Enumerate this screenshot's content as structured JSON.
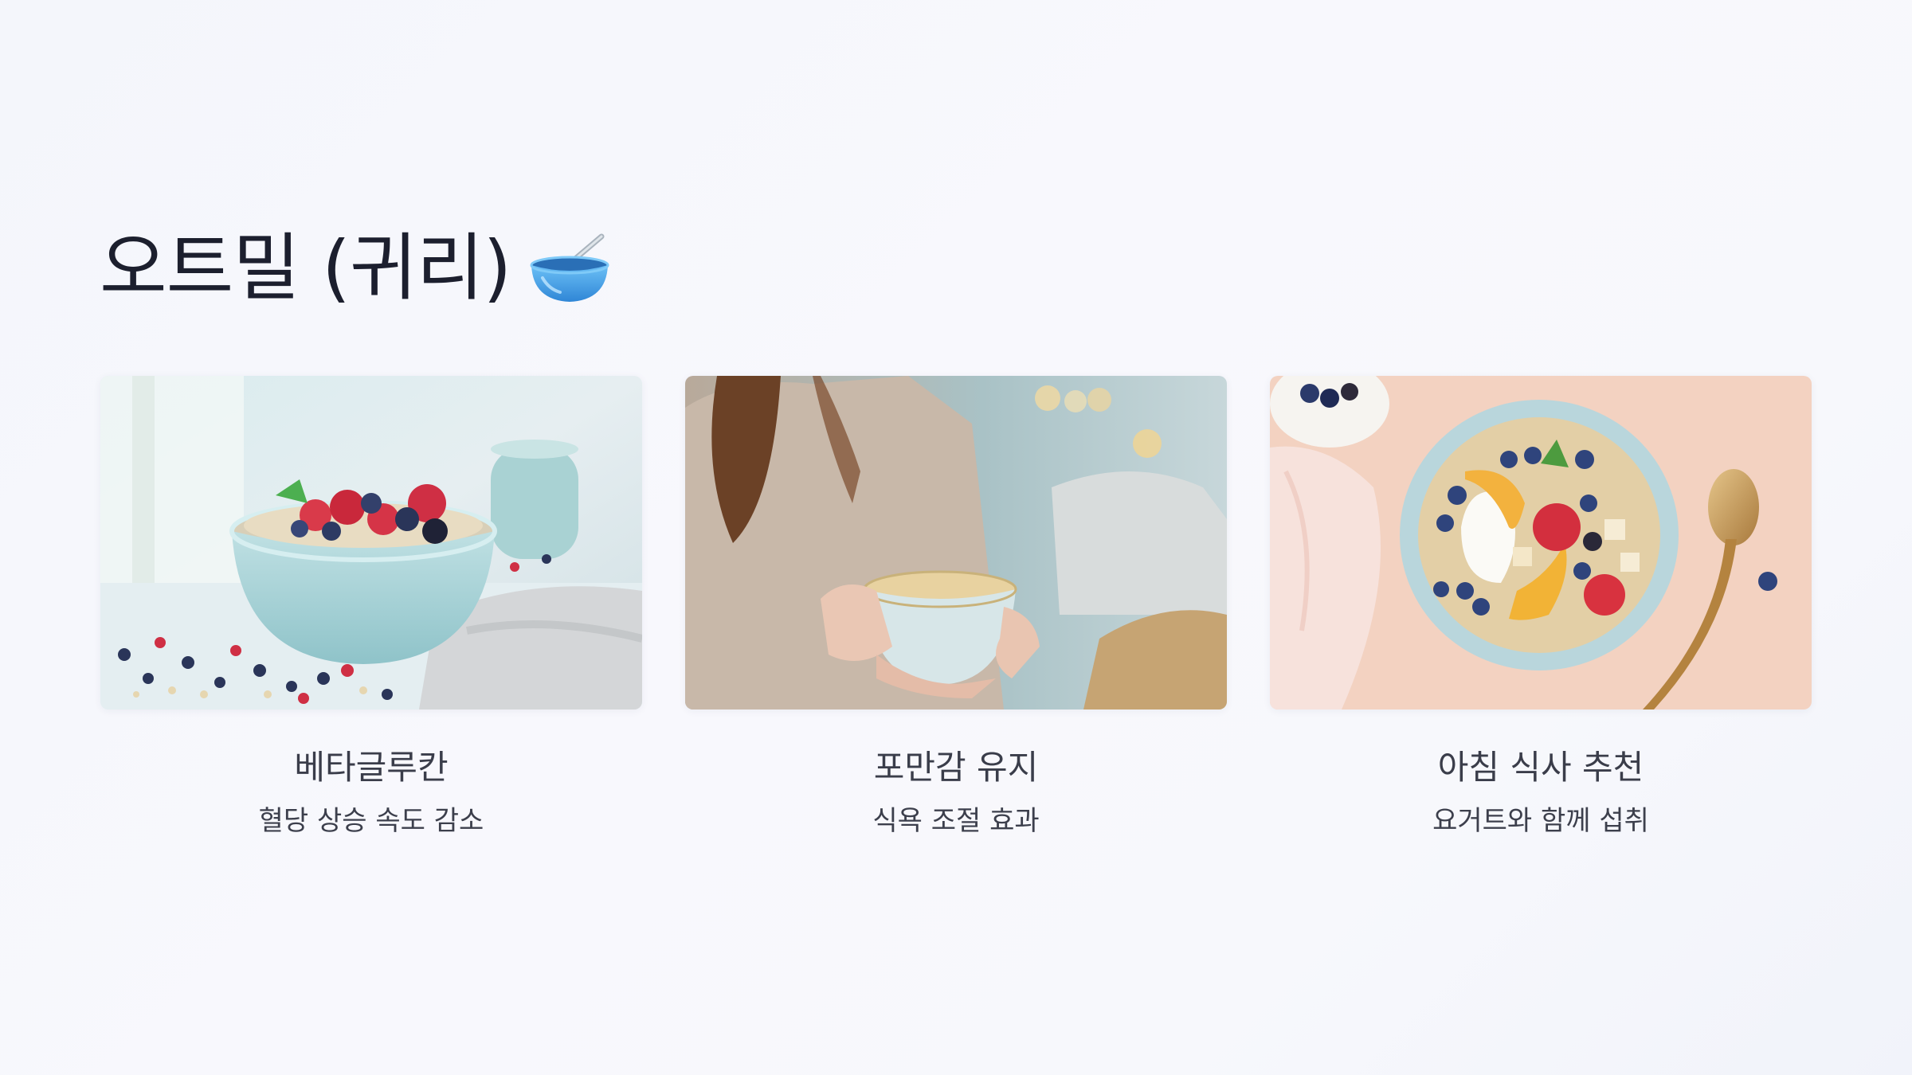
{
  "slide": {
    "title": "오트밀 (귀리)",
    "title_icon": "bowl-with-spoon-icon"
  },
  "cards": [
    {
      "image": "oatmeal-berries-bowl-photo",
      "title": "베타글루칸",
      "subtitle": "혈당 상승 속도 감소"
    },
    {
      "image": "woman-holding-oatmeal-bowl-photo",
      "title": "포만감 유지",
      "subtitle": "식욕 조절 효과"
    },
    {
      "image": "oatmeal-yogurt-fruit-bowl-photo",
      "title": "아침 식사 추천",
      "subtitle": "요거트와 함께 섭취"
    }
  ],
  "colors": {
    "background": "#f6f7fc",
    "title_text": "#1c1f2e",
    "card_text": "#3a3d4a",
    "bowl_blue": "#4aa3e8"
  }
}
